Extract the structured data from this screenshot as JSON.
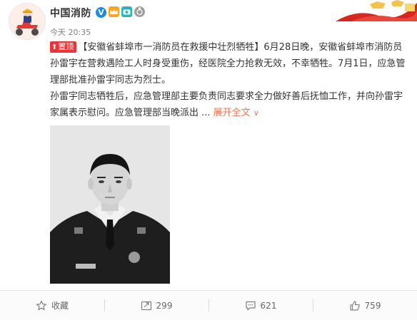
{
  "user": {
    "name": "中国消防",
    "verified_mark": "V",
    "timestamp": "今天 20:35"
  },
  "post": {
    "pin_label": "置顶",
    "title": "【安徽省蚌埠市一消防员在救援中壮烈牺牲】",
    "body_1": "6月28日晚，安徽省蚌埠市消防员孙雷宇在营救遇险工人时身受重伤，经医院全力抢救无效，不幸牺牲。7月1日，应急管理部批准孙雷宇同志为烈士。",
    "body_2": "孙雷宇同志牺牲后，应急管理部主要负责同志要求全力做好善后抚恤工作，并向孙雷宇家属表示慰问。应急管理部当晚派出 ...",
    "expand_label": "展开全文"
  },
  "actions": {
    "favorite_label": "收藏",
    "repost_count": "299",
    "comment_count": "621",
    "like_count": "759"
  },
  "colors": {
    "accent_orange": "#eb7350",
    "pin_red": "#e8353a",
    "verified_blue": "#1e88e5"
  }
}
